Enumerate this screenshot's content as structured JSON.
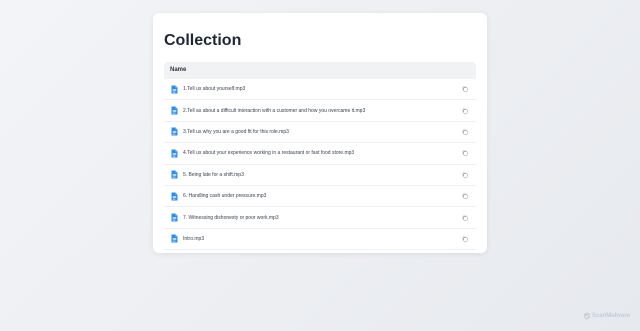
{
  "page": {
    "title": "Collection"
  },
  "table": {
    "header": "Name",
    "rows": [
      {
        "name": "1.Tell us about yourself.mp3"
      },
      {
        "name": "2.Tell as about a difficult interaction with a customer and how you overcame it.mp3"
      },
      {
        "name": "3.Tell us why you are a good fit for this role.mp3"
      },
      {
        "name": "4.Tell us about your experience working in a restaurant or fast food store.mp3"
      },
      {
        "name": "5. Being late for a shift.mp3"
      },
      {
        "name": "6. Handling cash under pressure.mp3"
      },
      {
        "name": "7. Witnessing dishonesty or poor work.mp3"
      },
      {
        "name": "Intro.mp3"
      }
    ]
  },
  "icons": {
    "file": "file-icon",
    "copy": "copy-icon",
    "brand": "shield-logo"
  },
  "colors": {
    "file_icon": "#2f8de4",
    "title": "#1f2733",
    "header_bg": "#f1f2f4"
  },
  "brand": {
    "name": "ScanMalware"
  }
}
